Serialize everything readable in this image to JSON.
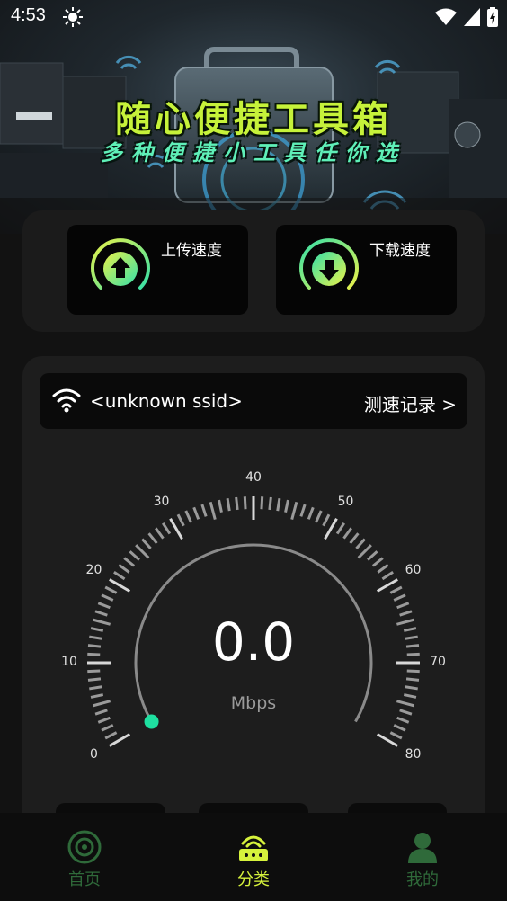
{
  "status_bar": {
    "time": "4:53",
    "icons": [
      "sun-icon",
      "wifi-icon",
      "signal-icon",
      "battery-charging-icon"
    ]
  },
  "hero": {
    "title": "随心便捷工具箱",
    "subtitle": "多种便捷小工具任你选",
    "title_color": "#c6f23a",
    "subtitle_color": "#5ff0b8"
  },
  "speed_cards": [
    {
      "label": "上传速度",
      "icon": "upload-gauge-icon"
    },
    {
      "label": "下载速度",
      "icon": "download-gauge-icon"
    }
  ],
  "wifi": {
    "ssid": "<unknown ssid>",
    "history_label": "测速记录 >"
  },
  "gauge": {
    "value": "0.0",
    "unit": "Mbps",
    "min": 0,
    "max": 80,
    "tick_labels": [
      "0",
      "10",
      "20",
      "30",
      "40",
      "50",
      "60",
      "70",
      "80"
    ],
    "needle_color": "#1ee0a0"
  },
  "bottom_nav": {
    "items": [
      {
        "label": "首页",
        "icon": "target-icon",
        "active": false
      },
      {
        "label": "分类",
        "icon": "router-icon",
        "active": true
      },
      {
        "label": "我的",
        "icon": "person-icon",
        "active": false
      }
    ],
    "active_color": "#d6f23c",
    "inactive_color": "#2f6a3a"
  }
}
